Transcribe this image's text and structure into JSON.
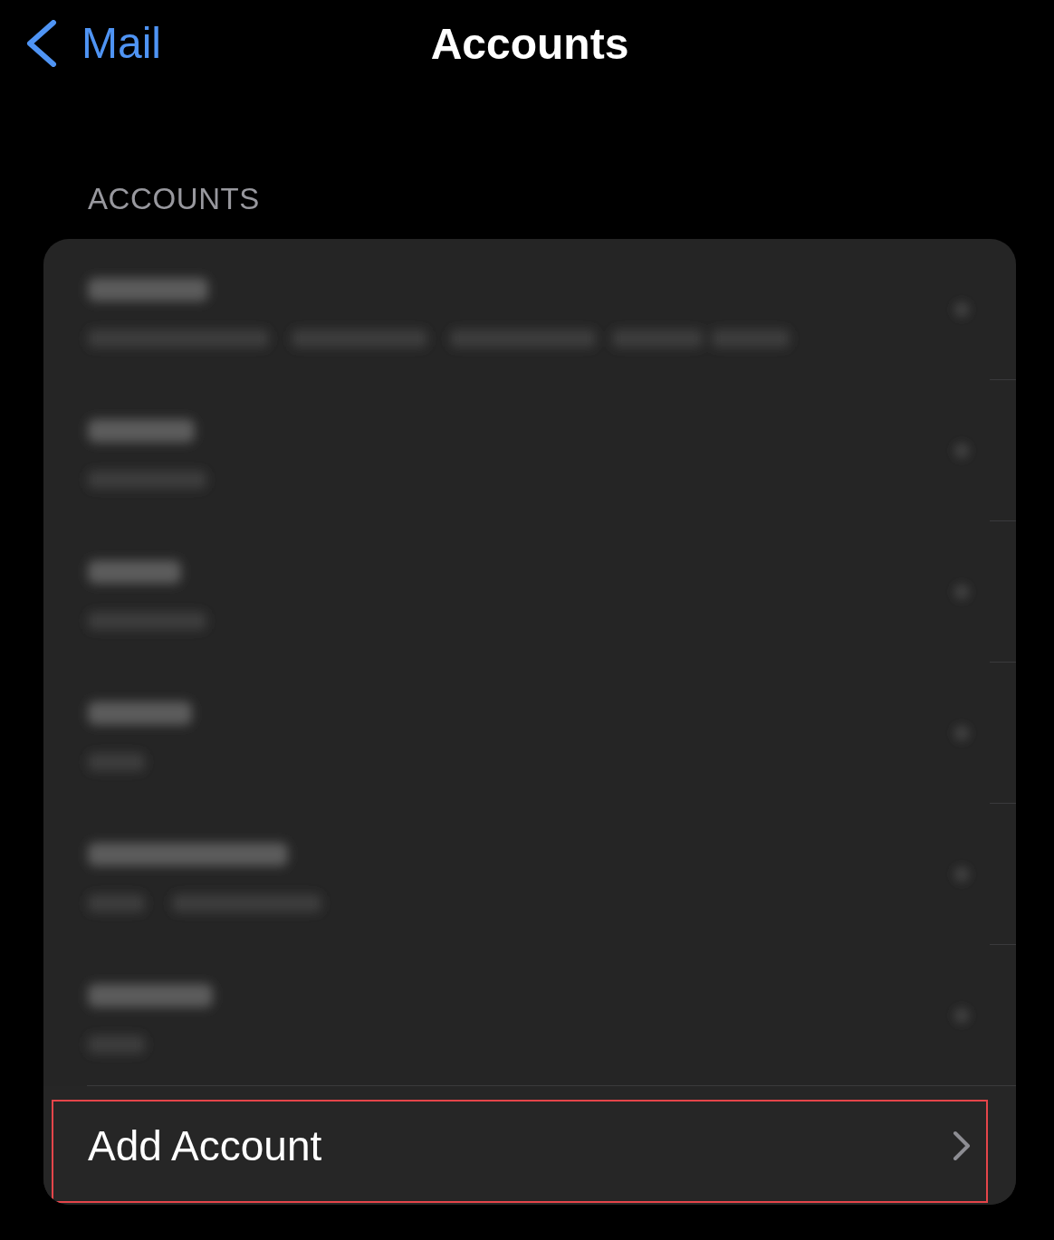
{
  "nav_bar": {
    "back_label": "Mail",
    "title": "Accounts"
  },
  "section_header": "ACCOUNTS",
  "accounts": [
    {
      "kind": "blurred"
    },
    {
      "kind": "blurred"
    },
    {
      "kind": "blurred"
    },
    {
      "kind": "blurred"
    },
    {
      "kind": "blurred"
    },
    {
      "kind": "blurred"
    }
  ],
  "add_account": {
    "label": "Add Account",
    "highlighted": true
  }
}
